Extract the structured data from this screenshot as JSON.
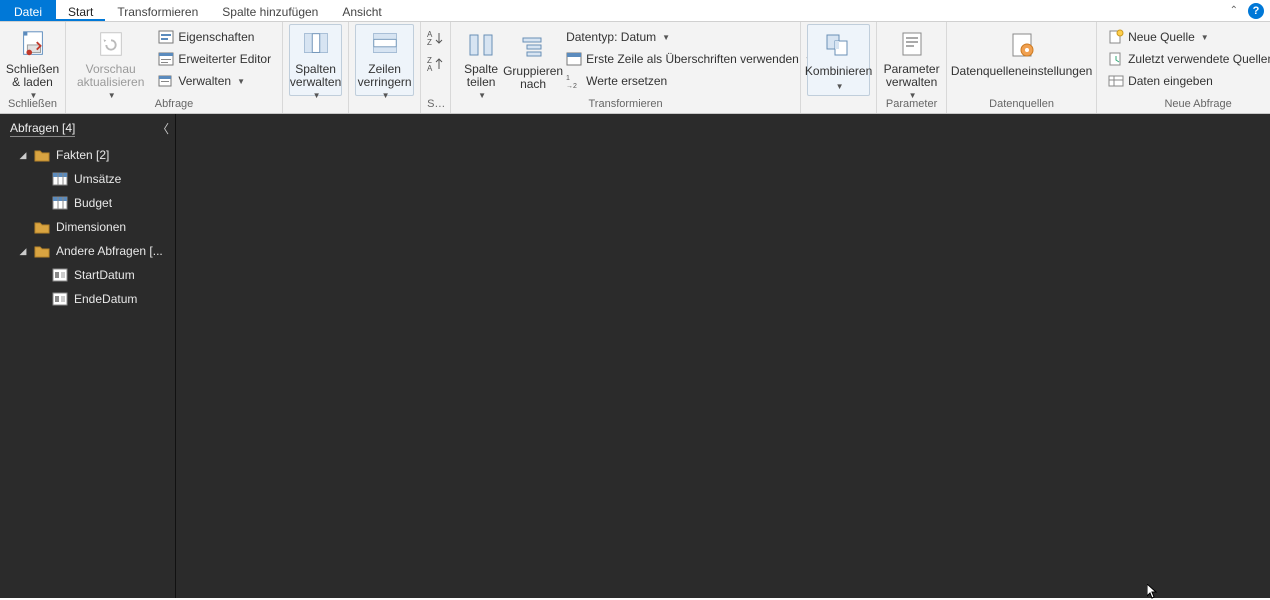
{
  "tabs": {
    "file": "Datei",
    "home": "Start",
    "transform": "Transformieren",
    "addcolumn": "Spalte hinzufügen",
    "view": "Ansicht"
  },
  "ribbon": {
    "close": {
      "btn": "Schließen\n& laden",
      "group": "Schließen"
    },
    "query": {
      "refresh": "Vorschau\naktualisieren",
      "props": "Eigenschaften",
      "adv": "Erweiterter Editor",
      "manage": "Verwalten",
      "group": "Abfrage"
    },
    "cols": {
      "btn": "Spalten\nverwalten"
    },
    "rows": {
      "btn": "Zeilen\nverringern"
    },
    "sort": {
      "group": "So..."
    },
    "split": {
      "btn": "Spalte\nteilen"
    },
    "groupby": {
      "btn": "Gruppieren\nnach"
    },
    "trans": {
      "datatype": "Datentyp: Datum",
      "firstrow": "Erste Zeile als Überschriften verwenden",
      "replace": "Werte ersetzen",
      "group": "Transformieren"
    },
    "combine": {
      "btn": "Kombinieren"
    },
    "params": {
      "btn": "Parameter\nverwalten",
      "group": "Parameter"
    },
    "dsrc": {
      "btn": "Datenquelleneinstellungen",
      "group": "Datenquellen"
    },
    "new": {
      "source": "Neue Quelle",
      "recent": "Zuletzt verwendete Quellen",
      "enter": "Daten eingeben",
      "group": "Neue Abfrage"
    }
  },
  "sidebar": {
    "title": "Abfragen [4]",
    "items": {
      "fakten": "Fakten [2]",
      "umsaetze": "Umsätze",
      "budget": "Budget",
      "dimensionen": "Dimensionen",
      "andere": "Andere Abfragen [...",
      "startdatum": "StartDatum",
      "endedatum": "EndeDatum"
    }
  }
}
